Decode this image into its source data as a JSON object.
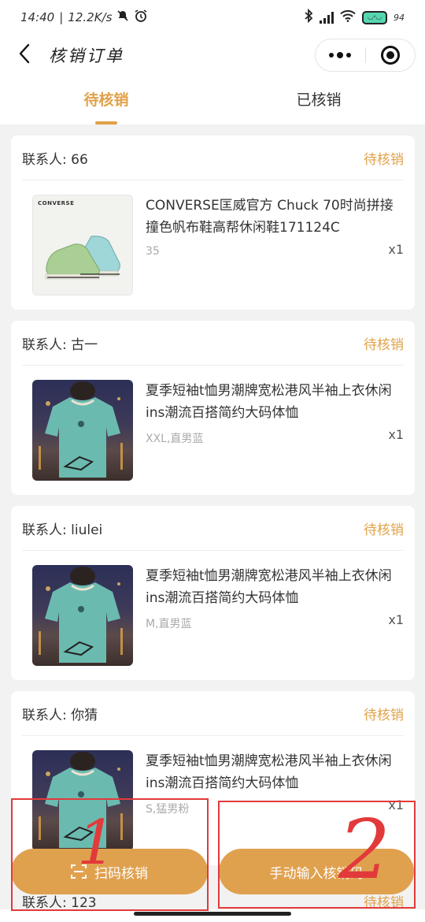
{
  "status_bar": {
    "time": "14:40",
    "speed": "12.2K/s",
    "battery_percent": "94"
  },
  "nav": {
    "title": "核销订单"
  },
  "tabs": [
    {
      "label": "待核销",
      "active": true
    },
    {
      "label": "已核销",
      "active": false
    }
  ],
  "orders": [
    {
      "contact": "联系人: 66",
      "status": "待核销",
      "brand_label": "CONVERSE",
      "title": "CONVERSE匡威官方 Chuck 70时尚拼接撞色帆布鞋高帮休闲鞋171124C",
      "sku": "35",
      "qty": "x1",
      "thumb_icon": "sneaker-product-image"
    },
    {
      "contact": "联系人: 古一",
      "status": "待核销",
      "title": "夏季短袖t恤男潮牌宽松港风半袖上衣休闲ins潮流百搭简约大码体恤",
      "sku": "XXL,直男蓝",
      "qty": "x1",
      "thumb_icon": "tshirt-product-image"
    },
    {
      "contact": "联系人: liulei",
      "status": "待核销",
      "title": "夏季短袖t恤男潮牌宽松港风半袖上衣休闲ins潮流百搭简约大码体恤",
      "sku": "M,直男蓝",
      "qty": "x1",
      "thumb_icon": "tshirt-product-image"
    },
    {
      "contact": "联系人: 你猜",
      "status": "待核销",
      "title": "夏季短袖t恤男潮牌宽松港风半袖上衣休闲ins潮流百搭简约大码体恤",
      "sku": "S,猛男粉",
      "qty": "x1",
      "thumb_icon": "tshirt-product-image"
    }
  ],
  "partial_order": {
    "contact": "联系人: 123",
    "status": "待核销"
  },
  "actions": {
    "scan_label": "扫码核销",
    "manual_label": "手动输入核销码"
  },
  "annotations": {
    "one": "1",
    "two": "2"
  },
  "colors": {
    "accent": "#e0a148",
    "button": "#e0a14f",
    "annotation": "#e23a3a"
  }
}
